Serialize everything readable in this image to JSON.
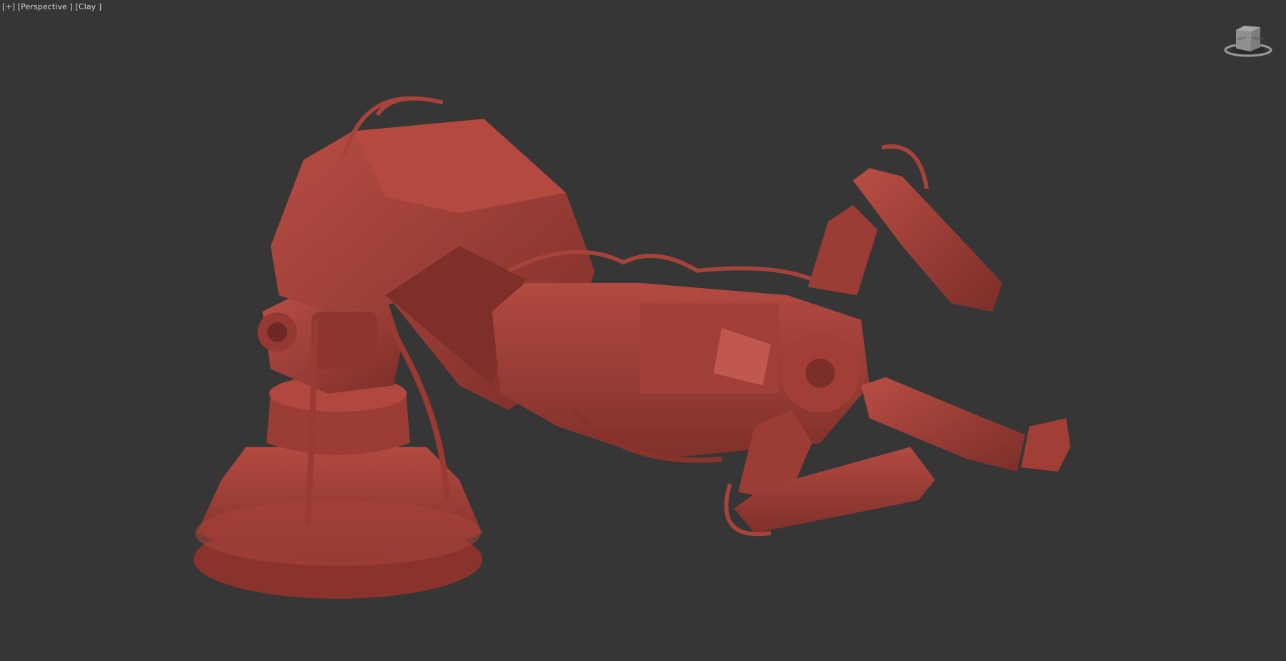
{
  "viewport": {
    "menu_plus": "[+]",
    "view_mode": "[Perspective ]",
    "shading_mode": "[Clay ]"
  },
  "viewcube": {
    "face_left": "LEFT",
    "face_front": "FRONT"
  },
  "colors": {
    "background": "#363636",
    "clay": "#a6433b",
    "clay_dark": "#6f2823",
    "clay_light": "#c0584e"
  }
}
